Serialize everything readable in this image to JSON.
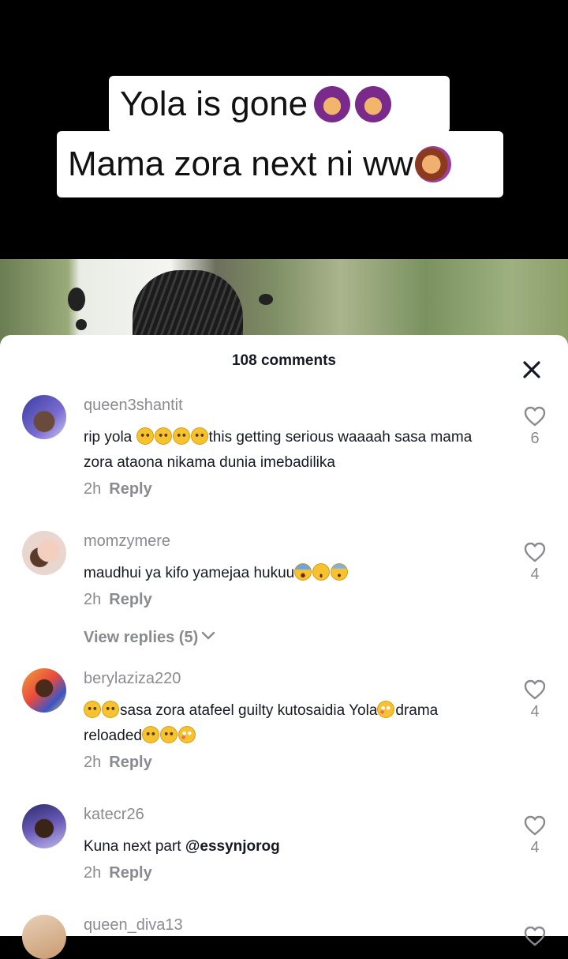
{
  "video": {
    "caption_line1": "Yola is gone",
    "caption_line2": "Mama zora next ni ww",
    "caption_icons": [
      "woman-gesturing-ok-icon",
      "woman-gesturing-ok-icon",
      "woman-facepalming-icon"
    ]
  },
  "comments_panel": {
    "title": "108 comments",
    "close_icon": "close-icon",
    "comments": [
      {
        "username": "queen3shantit",
        "text_before": "rip yola ",
        "emojis_mid": [
          "pleading-face",
          "pleading-face",
          "pleading-face",
          "pleading-face"
        ],
        "text_after": "this getting serious waaaah sasa mama zora ataona nikama dunia imebadilika",
        "time": "2h",
        "reply": "Reply",
        "likes": "6"
      },
      {
        "username": "momzymere",
        "text_before": "maudhui ya kifo yamejaa hukuu",
        "emojis_end": [
          "screaming-face",
          "unamused-face",
          "fearful-face"
        ],
        "time": "2h",
        "reply": "Reply",
        "likes": "4",
        "view_replies": "View replies (5)"
      },
      {
        "username": "berylaziza220",
        "emojis_start": [
          "pleading-face",
          "pleading-face"
        ],
        "text_mid": "sasa zora atafeel guilty kutosaidia Yola",
        "emoji_mid2": "flushed-face",
        "text_after": "drama reloaded",
        "emojis_end": [
          "pleading-face",
          "pleading-face",
          "flushed-face"
        ],
        "time": "2h",
        "reply": "Reply",
        "likes": "4"
      },
      {
        "username": "katecr26",
        "text_before": "Kuna next part ",
        "mention": "@essynjorog",
        "time": "2h",
        "reply": "Reply",
        "likes": "4"
      },
      {
        "username": "queen_diva13"
      }
    ]
  },
  "colors": {
    "text_primary": "#161823",
    "text_secondary": "#8a8b91",
    "sheet_bg": "#ffffff"
  }
}
